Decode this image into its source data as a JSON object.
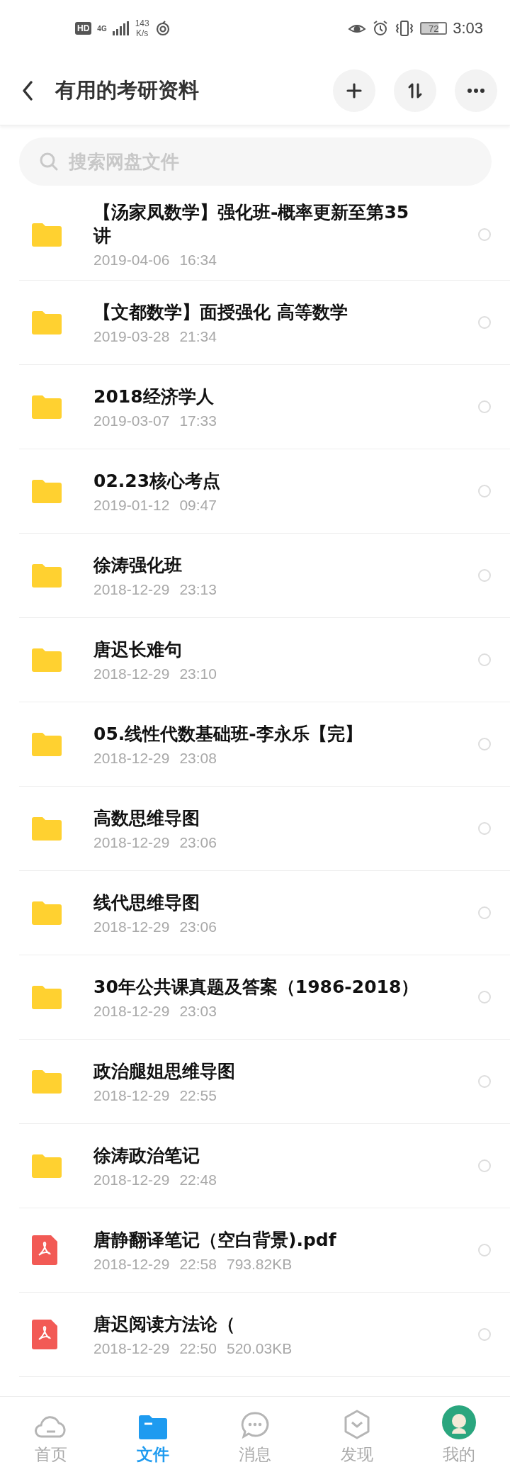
{
  "status_bar": {
    "hd_badge": "HD",
    "network_type": "4G",
    "speed_value": "143",
    "speed_unit": "K/s",
    "battery": "72",
    "time": "3:03"
  },
  "header": {
    "title": "有用的考研资料"
  },
  "search": {
    "placeholder": "搜索网盘文件"
  },
  "files": [
    {
      "kind": "folder",
      "name": "【汤家凤数学】强化班-概率更新至第35讲",
      "date": "2019-04-06",
      "time": "16:34",
      "selected": false
    },
    {
      "kind": "folder",
      "name": "【文都数学】面授强化 高等数学",
      "date": "2019-03-28",
      "time": "21:34",
      "selected": false
    },
    {
      "kind": "folder",
      "name": "2018经济学人",
      "date": "2019-03-07",
      "time": "17:33",
      "selected": false
    },
    {
      "kind": "folder",
      "name": "02.23核心考点",
      "date": "2019-01-12",
      "time": "09:47",
      "selected": false
    },
    {
      "kind": "folder",
      "name": "徐涛强化班",
      "date": "2018-12-29",
      "time": "23:13",
      "selected": false
    },
    {
      "kind": "folder",
      "name": "唐迟长难句",
      "date": "2018-12-29",
      "time": "23:10",
      "selected": false
    },
    {
      "kind": "folder",
      "name": "05.线性代数基础班-李永乐【完】",
      "date": "2018-12-29",
      "time": "23:08",
      "selected": false
    },
    {
      "kind": "folder",
      "name": "高数思维导图",
      "date": "2018-12-29",
      "time": "23:06",
      "selected": false
    },
    {
      "kind": "folder",
      "name": "线代思维导图",
      "date": "2018-12-29",
      "time": "23:06",
      "selected": false
    },
    {
      "kind": "folder",
      "name": "30年公共课真题及答案（1986-2018）",
      "date": "2018-12-29",
      "time": "23:03",
      "selected": false
    },
    {
      "kind": "folder",
      "name": "政治腿姐思维导图",
      "date": "2018-12-29",
      "time": "22:55",
      "selected": false
    },
    {
      "kind": "folder",
      "name": "徐涛政治笔记",
      "date": "2018-12-29",
      "time": "22:48",
      "selected": false
    },
    {
      "kind": "pdf",
      "name": "唐静翻译笔记（空白背景).pdf",
      "date": "2018-12-29",
      "time": "22:58",
      "size": "793.82KB",
      "selected": false
    },
    {
      "kind": "pdf",
      "name": "唐迟阅读方法论（",
      "date": "2018-12-29",
      "time": "22:50",
      "size": "520.03KB",
      "selected": false
    }
  ],
  "tabs": [
    {
      "kind": "home",
      "label": "首页",
      "selected": false
    },
    {
      "kind": "files",
      "label": "文件",
      "selected": true
    },
    {
      "kind": "messages",
      "label": "消息",
      "selected": false
    },
    {
      "kind": "discover",
      "label": "发现",
      "selected": false
    },
    {
      "kind": "profile",
      "label": "我的",
      "selected": false
    }
  ]
}
